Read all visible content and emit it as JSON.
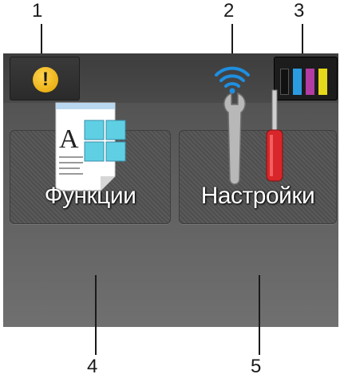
{
  "callouts": {
    "one": "1",
    "two": "2",
    "three": "3",
    "four": "4",
    "five": "5"
  },
  "header": {
    "alert_icon_glyph": "!",
    "wifi_icon": "wifi-icon",
    "ink_colors": {
      "black": "#1a1a1a",
      "cyan": "#2a9be0",
      "magenta": "#b23ca3",
      "yellow": "#e6d81a"
    }
  },
  "tiles": {
    "functions": {
      "label": "Функции",
      "icon": "document-functions-icon",
      "icon_letter": "A"
    },
    "settings": {
      "label": "Настройки",
      "icon": "tools-icon"
    }
  },
  "colors": {
    "accent_wifi": "#1f8fe0",
    "alert": "#f5c200"
  }
}
